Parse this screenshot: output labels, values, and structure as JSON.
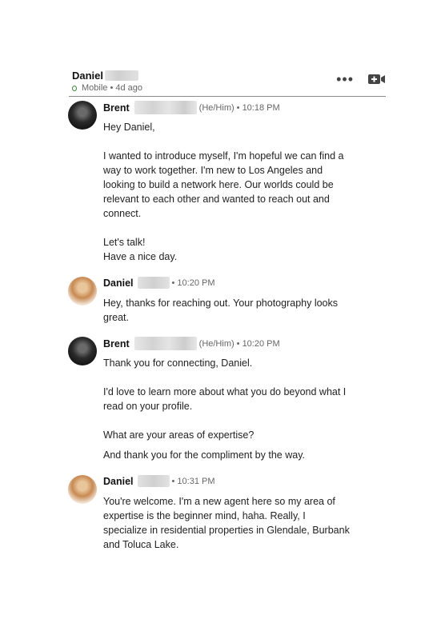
{
  "header": {
    "contact_name": "Daniel",
    "status": "Mobile • 4d ago",
    "more_label": "•••"
  },
  "messages": [
    {
      "sender": "Brent",
      "pronouns": "(He/Him)",
      "time": "• 10:18 PM",
      "lines": [
        "Hey Daniel,",
        "I wanted to introduce myself, I'm hopeful we can find a way to work together. I'm new to Los Angeles and looking to build a network here. Our worlds could be relevant to each other and wanted to reach out and connect.",
        "Let's talk!",
        "Have a nice day."
      ]
    },
    {
      "sender": "Daniel",
      "time": "• 10:20 PM",
      "lines": [
        "Hey, thanks for reaching out. Your photography looks great."
      ]
    },
    {
      "sender": "Brent",
      "pronouns": "(He/Him)",
      "time": "• 10:20 PM",
      "lines": [
        "Thank you for connecting, Daniel.",
        "I'd love to learn more about what you do beyond what I read on your profile.",
        "What are your areas of expertise?",
        "And thank you for the compliment by the way."
      ]
    },
    {
      "sender": "Daniel",
      "time": "• 10:31 PM",
      "lines": [
        "You're welcome. I'm a new agent here so my area of expertise is the beginner mind, haha. Really, I specialize in residential properties in Glendale, Burbank and Toluca Lake."
      ]
    }
  ]
}
